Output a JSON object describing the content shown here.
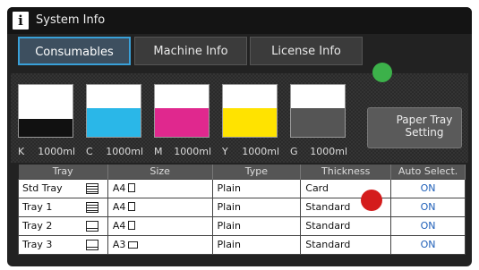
{
  "window": {
    "title": "System Info",
    "icon": "info-icon"
  },
  "tabs": [
    {
      "label": "Consumables",
      "active": true
    },
    {
      "label": "Machine Info",
      "active": false
    },
    {
      "label": "License Info",
      "active": false
    }
  ],
  "toners": [
    {
      "code": "K",
      "amount": "1000ml",
      "color": "#111111",
      "level_percent": 35
    },
    {
      "code": "C",
      "amount": "1000ml",
      "color": "#2ab7e8",
      "level_percent": 55
    },
    {
      "code": "M",
      "amount": "1000ml",
      "color": "#e0288e",
      "level_percent": 55
    },
    {
      "code": "Y",
      "amount": "1000ml",
      "color": "#ffe300",
      "level_percent": 55
    },
    {
      "code": "G",
      "amount": "1000ml",
      "color": "#555555",
      "level_percent": 55
    }
  ],
  "paper_tray_button": {
    "label_line1": "Paper Tray",
    "label_line2": "Setting"
  },
  "table": {
    "headers": [
      "Tray",
      "Size",
      "Type",
      "Thickness",
      "Auto Select."
    ],
    "rows": [
      {
        "tray": "Std Tray",
        "size": "A4",
        "type": "Plain",
        "thickness": "Card",
        "auto": "ON",
        "tray_icon": "stack-icon",
        "paper": "portrait"
      },
      {
        "tray": "Tray 1",
        "size": "A4",
        "type": "Plain",
        "thickness": "Standard",
        "auto": "ON",
        "tray_icon": "stack-icon",
        "paper": "portrait"
      },
      {
        "tray": "Tray 2",
        "size": "A4",
        "type": "Plain",
        "thickness": "Standard",
        "auto": "ON",
        "tray_icon": "tray-icon",
        "paper": "portrait"
      },
      {
        "tray": "Tray 3",
        "size": "A3",
        "type": "Plain",
        "thickness": "Standard",
        "auto": "ON",
        "tray_icon": "tray-icon",
        "paper": "landscape"
      }
    ]
  },
  "colors": {
    "accent": "#39a0d8",
    "on_text": "#1f5fb8",
    "status_green": "#3cb14a",
    "marker_red": "#d41c1c"
  }
}
